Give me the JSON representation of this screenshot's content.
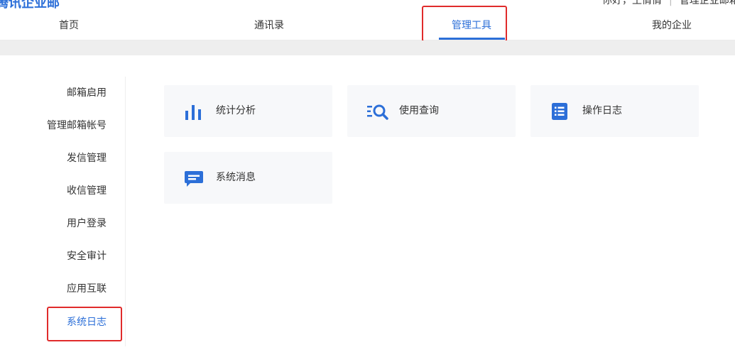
{
  "header": {
    "brand": "腾讯企业邮",
    "user_text": "你好，王倩倩",
    "user_link": "管理企业邮箱"
  },
  "nav": {
    "items": [
      {
        "label": "首页"
      },
      {
        "label": "通讯录"
      },
      {
        "label": "管理工具",
        "active": true
      },
      {
        "label": "我的企业"
      }
    ]
  },
  "sidebar": {
    "items": [
      {
        "label": "邮箱启用"
      },
      {
        "label": "管理邮箱帐号"
      },
      {
        "label": "发信管理"
      },
      {
        "label": "收信管理"
      },
      {
        "label": "用户登录"
      },
      {
        "label": "安全审计"
      },
      {
        "label": "应用互联"
      },
      {
        "label": "系统日志",
        "active": true
      }
    ]
  },
  "tools": {
    "cards": [
      {
        "label": "统计分析",
        "icon": "bar-chart-icon"
      },
      {
        "label": "使用查询",
        "icon": "search-list-icon"
      },
      {
        "label": "操作日志",
        "icon": "log-list-icon"
      },
      {
        "label": "系统消息",
        "icon": "message-icon"
      }
    ]
  },
  "colors": {
    "accent": "#2c6fd8",
    "highlight": "#e02b2b",
    "card_bg": "#f7f8fa"
  }
}
